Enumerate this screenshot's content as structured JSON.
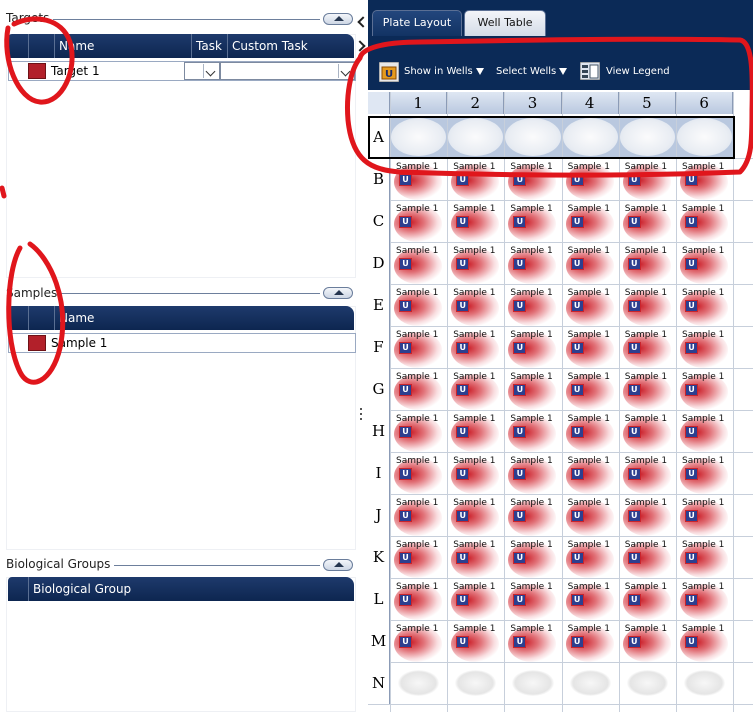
{
  "left": {
    "targets": {
      "title": "Targets",
      "columns": [
        "Name",
        "Task",
        "Custom Task"
      ],
      "rows": [
        {
          "name": "Target 1",
          "color": "#b2202a"
        }
      ]
    },
    "samples": {
      "title": "Samples",
      "columns": [
        "Name"
      ],
      "rows": [
        {
          "name": "Sample 1",
          "color": "#b2202a"
        }
      ]
    },
    "bio_groups": {
      "title": "Biological Groups",
      "columns": [
        "Biological Group"
      ]
    }
  },
  "tabs": [
    {
      "label": "Plate Layout",
      "active": true
    },
    {
      "label": "Well Table",
      "active": false
    }
  ],
  "toolbar": {
    "show_in_wells": "Show in Wells",
    "select_wells": "Select Wells",
    "view_legend": "View Legend"
  },
  "plate": {
    "columns": [
      "1",
      "2",
      "3",
      "4",
      "5",
      "6"
    ],
    "rows": [
      "A",
      "B",
      "C",
      "D",
      "E",
      "F",
      "G",
      "H",
      "I",
      "J",
      "K",
      "L",
      "M",
      "N"
    ],
    "selected_row": "A",
    "sample_rows": [
      "B",
      "C",
      "D",
      "E",
      "F",
      "G",
      "H",
      "I",
      "J",
      "K",
      "L",
      "M"
    ],
    "well_label": "Sample 1",
    "well_task_badge": "U"
  },
  "colors": {
    "header_navy": "#0b2a57",
    "sample_red": "#b2202a",
    "annotation_red": "#e0161c"
  }
}
